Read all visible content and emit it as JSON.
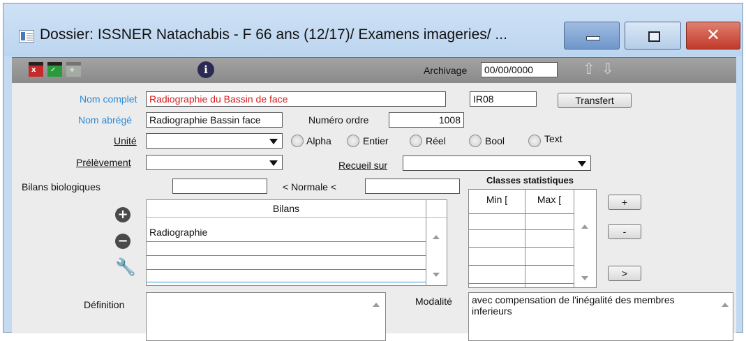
{
  "window": {
    "title": "Dossier: ISSNER Natachabis - F 66 ans (12/17)/ Examens imageries/ ...",
    "controls": {
      "close": "✕"
    }
  },
  "toolbar": {
    "info_icon": "i",
    "archivage_label": "Archivage",
    "archivage_value": "00/00/0000",
    "up_arrow": "⇧",
    "down_arrow": "⇩"
  },
  "form": {
    "nom_complet_label": "Nom complet",
    "nom_complet_value": "Radiographie du Bassin de face",
    "code_value": "IR08",
    "transfert_label": "Transfert",
    "nom_abrege_label": "Nom abrégé",
    "nom_abrege_value": "Radiographie Bassin face",
    "numero_ordre_label": "Numéro ordre",
    "numero_ordre_value": "1008",
    "unite_label": "Unité",
    "unite_value": "",
    "radio_options": [
      "Alpha",
      "Entier",
      "Réel",
      "Bool",
      "Text"
    ],
    "prelevement_label": "Prélèvement",
    "prelevement_value": "",
    "recueil_label": "Recueil sur",
    "recueil_value": "",
    "bilans_bio_label": "Bilans biologiques",
    "normale_label": "< Normale  <",
    "bilans_header": "Bilans",
    "bilans_rows": [
      "Radiographie",
      "",
      "",
      ""
    ],
    "classes_title": "Classes statistiques",
    "min_header": "Min [",
    "max_header": "Max [",
    "plus_label": "+",
    "minus_label": "-",
    "next_label": ">",
    "definition_label": "Définition",
    "definition_value": "",
    "modalite_label": "Modalité",
    "modalite_value": "avec compensation de l'inégalité des membres inferieurs"
  },
  "icons": {
    "add": "+",
    "remove": "−",
    "wrench": "🔧"
  }
}
